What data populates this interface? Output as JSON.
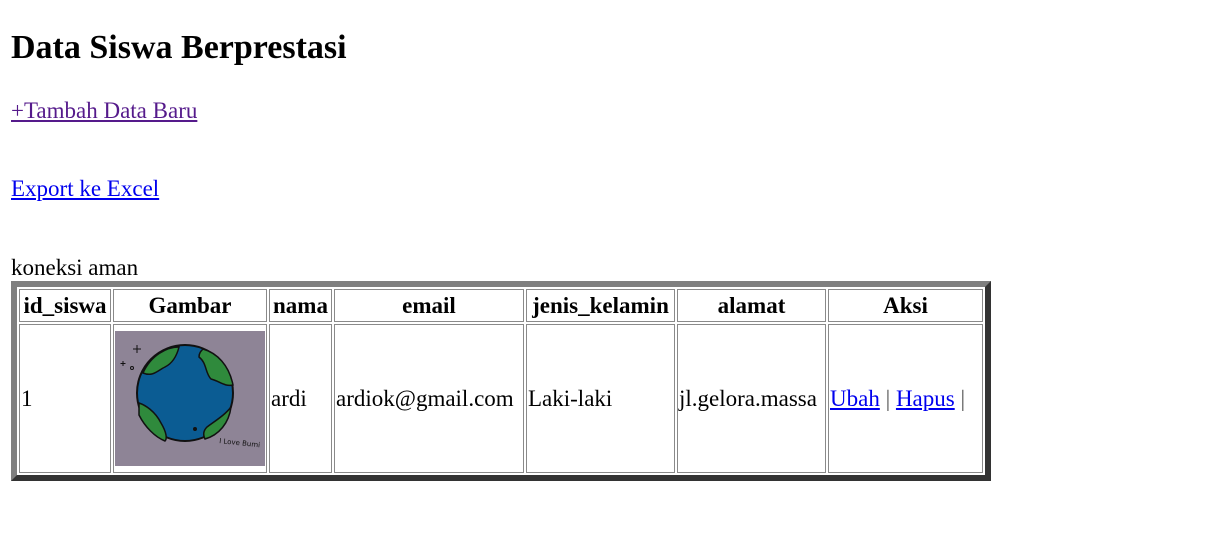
{
  "page": {
    "title": "Data Siswa Berprestasi",
    "add_link": "+Tambah Data Baru",
    "export_link": "Export ke Excel",
    "status_text": "koneksi aman"
  },
  "table": {
    "headers": [
      "id_siswa",
      "Gambar",
      "nama",
      "email",
      "jenis_kelamin",
      "alamat",
      "Aksi"
    ],
    "rows": [
      {
        "id_siswa": "1",
        "gambar_caption": "I Love Bumi",
        "nama": "ardi",
        "email": "ardiok@gmail.com",
        "jenis_kelamin": "Laki-laki",
        "alamat": "jl.gelora.massa",
        "aksi_edit": "Ubah",
        "aksi_sep": "|",
        "aksi_delete": "Hapus",
        "aksi_trail": "|"
      }
    ]
  },
  "colors": {
    "link": "#0000ee",
    "visited_link": "#551a8b",
    "photo_bg": "#8e8496",
    "earth_ocean": "#0b5c93",
    "earth_land": "#2f8a3c"
  }
}
